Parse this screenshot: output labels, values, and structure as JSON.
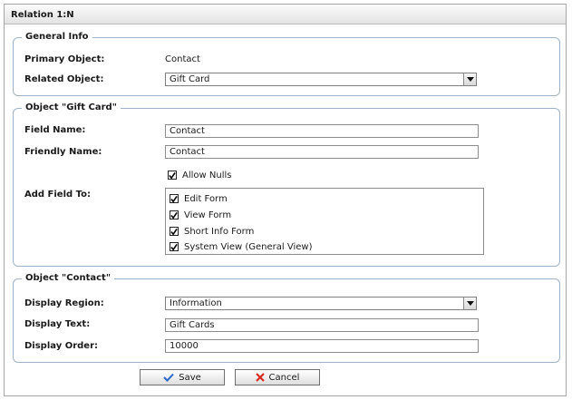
{
  "dialog": {
    "title": "Relation 1:N"
  },
  "general": {
    "legend": "General Info",
    "primary_label": "Primary Object:",
    "primary_value": "Contact",
    "related_label": "Related Object:",
    "related_value": "Gift Card"
  },
  "object_gift": {
    "legend": "Object \"Gift Card\"",
    "field_name_label": "Field Name:",
    "field_name_value": "Contact",
    "friendly_label": "Friendly Name:",
    "friendly_value": "Contact",
    "allow_nulls_label": "Allow Nulls",
    "allow_nulls_checked": true,
    "add_field_label": "Add Field To:",
    "forms": [
      {
        "label": "Edit Form",
        "checked": true
      },
      {
        "label": "View Form",
        "checked": true
      },
      {
        "label": "Short Info Form",
        "checked": true
      },
      {
        "label": "System View (General View)",
        "checked": true
      }
    ]
  },
  "object_contact": {
    "legend": "Object \"Contact\"",
    "region_label": "Display Region:",
    "region_value": "Information",
    "text_label": "Display Text:",
    "text_value": "Gift Cards",
    "order_label": "Display Order:",
    "order_value": "10000"
  },
  "buttons": {
    "save": "Save",
    "cancel": "Cancel"
  },
  "colors": {
    "save_icon": "#2a66c9",
    "cancel_icon": "#d82a1e"
  },
  "icons": {
    "save": "checkmark-icon",
    "cancel": "x-icon",
    "dropdown": "chevron-down-icon",
    "checkbox": "checkmark-icon"
  }
}
